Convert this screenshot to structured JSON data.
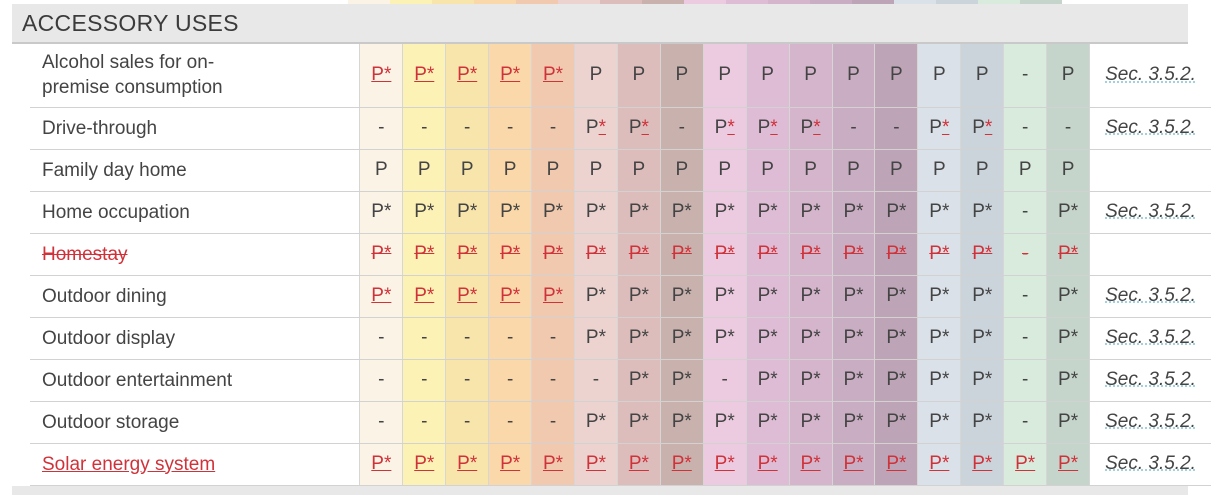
{
  "section": {
    "title": "ACCESSORY USES"
  },
  "column_colors": [
    "#faf3e6",
    "#fdf2b6",
    "#f8e5ac",
    "#fad8a9",
    "#f1c9ae",
    "#ecd3cf",
    "#dcbdbc",
    "#c9b2ae",
    "#eccbe0",
    "#dfbcd5",
    "#d4b5cb",
    "#c9adc2",
    "#bda5b7",
    "#dae1e8",
    "#cbd3db",
    "#d9ebdd",
    "#c5d5cc"
  ],
  "rows": [
    {
      "label": "Alcohol sales for on-premise consumption",
      "label_lines": [
        "Alcohol sales for on-",
        "premise consumption"
      ],
      "label_style": "normal",
      "cells": [
        [
          "P*",
          "ru"
        ],
        [
          "P*",
          "ru"
        ],
        [
          "P*",
          "ru"
        ],
        [
          "P*",
          "ru"
        ],
        [
          "P*",
          "ru"
        ],
        [
          "P",
          ""
        ],
        [
          "P",
          ""
        ],
        [
          "P",
          ""
        ],
        [
          "P",
          ""
        ],
        [
          "P",
          ""
        ],
        [
          "P",
          ""
        ],
        [
          "P",
          ""
        ],
        [
          "P",
          ""
        ],
        [
          "P",
          ""
        ],
        [
          "P",
          ""
        ],
        [
          "-",
          ""
        ],
        [
          "P",
          ""
        ]
      ],
      "ref": "Sec. 3.5.2."
    },
    {
      "label": "Drive-through",
      "label_style": "normal",
      "cells": [
        [
          "-",
          ""
        ],
        [
          "-",
          ""
        ],
        [
          "-",
          ""
        ],
        [
          "-",
          ""
        ],
        [
          "-",
          ""
        ],
        [
          "P*",
          "su"
        ],
        [
          "P*",
          "su"
        ],
        [
          "-",
          ""
        ],
        [
          "P*",
          "su"
        ],
        [
          "P*",
          "su"
        ],
        [
          "P*",
          "su"
        ],
        [
          "-",
          ""
        ],
        [
          "-",
          ""
        ],
        [
          "P*",
          "su"
        ],
        [
          "P*",
          "su"
        ],
        [
          "-",
          ""
        ],
        [
          "-",
          ""
        ]
      ],
      "ref": "Sec. 3.5.2."
    },
    {
      "label": "Family day home",
      "label_style": "normal",
      "cells": [
        [
          "P",
          ""
        ],
        [
          "P",
          ""
        ],
        [
          "P",
          ""
        ],
        [
          "P",
          ""
        ],
        [
          "P",
          ""
        ],
        [
          "P",
          ""
        ],
        [
          "P",
          ""
        ],
        [
          "P",
          ""
        ],
        [
          "P",
          ""
        ],
        [
          "P",
          ""
        ],
        [
          "P",
          ""
        ],
        [
          "P",
          ""
        ],
        [
          "P",
          ""
        ],
        [
          "P",
          ""
        ],
        [
          "P",
          ""
        ],
        [
          "P",
          ""
        ],
        [
          "P",
          ""
        ]
      ],
      "ref": ""
    },
    {
      "label": "Home occupation",
      "label_style": "normal",
      "cells": [
        [
          "P*",
          ""
        ],
        [
          "P*",
          ""
        ],
        [
          "P*",
          ""
        ],
        [
          "P*",
          ""
        ],
        [
          "P*",
          ""
        ],
        [
          "P*",
          ""
        ],
        [
          "P*",
          ""
        ],
        [
          "P*",
          ""
        ],
        [
          "P*",
          ""
        ],
        [
          "P*",
          ""
        ],
        [
          "P*",
          ""
        ],
        [
          "P*",
          ""
        ],
        [
          "P*",
          ""
        ],
        [
          "P*",
          ""
        ],
        [
          "P*",
          ""
        ],
        [
          "-",
          ""
        ],
        [
          "P*",
          ""
        ]
      ],
      "ref": "Sec. 3.5.2."
    },
    {
      "label": "Homestay",
      "label_style": "strike",
      "cells": [
        [
          "P*",
          "rs"
        ],
        [
          "P*",
          "rs"
        ],
        [
          "P*",
          "rs"
        ],
        [
          "P*",
          "rs"
        ],
        [
          "P*",
          "rs"
        ],
        [
          "P*",
          "rs"
        ],
        [
          "P*",
          "rs"
        ],
        [
          "P*",
          "rs"
        ],
        [
          "P*",
          "rs"
        ],
        [
          "P*",
          "rs"
        ],
        [
          "P*",
          "rs"
        ],
        [
          "P*",
          "rs"
        ],
        [
          "P*",
          "rs"
        ],
        [
          "P*",
          "rs"
        ],
        [
          "P*",
          "rs"
        ],
        [
          "-",
          "rs"
        ],
        [
          "P*",
          "rs"
        ]
      ],
      "ref": ""
    },
    {
      "label": "Outdoor dining",
      "label_style": "normal",
      "cells": [
        [
          "P*",
          "ru"
        ],
        [
          "P*",
          "ru"
        ],
        [
          "P*",
          "ru"
        ],
        [
          "P*",
          "ru"
        ],
        [
          "P*",
          "ru"
        ],
        [
          "P*",
          ""
        ],
        [
          "P*",
          ""
        ],
        [
          "P*",
          ""
        ],
        [
          "P*",
          ""
        ],
        [
          "P*",
          ""
        ],
        [
          "P*",
          ""
        ],
        [
          "P*",
          ""
        ],
        [
          "P*",
          ""
        ],
        [
          "P*",
          ""
        ],
        [
          "P*",
          ""
        ],
        [
          "-",
          ""
        ],
        [
          "P*",
          ""
        ]
      ],
      "ref": "Sec. 3.5.2."
    },
    {
      "label": "Outdoor display",
      "label_style": "normal",
      "cells": [
        [
          "-",
          ""
        ],
        [
          "-",
          ""
        ],
        [
          "-",
          ""
        ],
        [
          "-",
          ""
        ],
        [
          "-",
          ""
        ],
        [
          "P*",
          ""
        ],
        [
          "P*",
          ""
        ],
        [
          "P*",
          ""
        ],
        [
          "P*",
          ""
        ],
        [
          "P*",
          ""
        ],
        [
          "P*",
          ""
        ],
        [
          "P*",
          ""
        ],
        [
          "P*",
          ""
        ],
        [
          "P*",
          ""
        ],
        [
          "P*",
          ""
        ],
        [
          "-",
          ""
        ],
        [
          "P*",
          ""
        ]
      ],
      "ref": "Sec. 3.5.2."
    },
    {
      "label": "Outdoor entertainment",
      "label_style": "normal",
      "cells": [
        [
          "-",
          ""
        ],
        [
          "-",
          ""
        ],
        [
          "-",
          ""
        ],
        [
          "-",
          ""
        ],
        [
          "-",
          ""
        ],
        [
          "-",
          ""
        ],
        [
          "P*",
          ""
        ],
        [
          "P*",
          ""
        ],
        [
          "-",
          ""
        ],
        [
          "P*",
          ""
        ],
        [
          "P*",
          ""
        ],
        [
          "P*",
          ""
        ],
        [
          "P*",
          ""
        ],
        [
          "P*",
          ""
        ],
        [
          "P*",
          ""
        ],
        [
          "-",
          ""
        ],
        [
          "P*",
          ""
        ]
      ],
      "ref": "Sec. 3.5.2."
    },
    {
      "label": "Outdoor storage",
      "label_style": "normal",
      "cells": [
        [
          "-",
          ""
        ],
        [
          "-",
          ""
        ],
        [
          "-",
          ""
        ],
        [
          "-",
          ""
        ],
        [
          "-",
          ""
        ],
        [
          "P*",
          ""
        ],
        [
          "P*",
          ""
        ],
        [
          "P*",
          ""
        ],
        [
          "P*",
          ""
        ],
        [
          "P*",
          ""
        ],
        [
          "P*",
          ""
        ],
        [
          "P*",
          ""
        ],
        [
          "P*",
          ""
        ],
        [
          "P*",
          ""
        ],
        [
          "P*",
          ""
        ],
        [
          "-",
          ""
        ],
        [
          "P*",
          ""
        ]
      ],
      "ref": "Sec. 3.5.2."
    },
    {
      "label": "Solar energy system",
      "label_style": "redunder",
      "cells": [
        [
          "P*",
          "ru"
        ],
        [
          "P*",
          "ru"
        ],
        [
          "P*",
          "ru"
        ],
        [
          "P*",
          "ru"
        ],
        [
          "P*",
          "ru"
        ],
        [
          "P*",
          "ru"
        ],
        [
          "P*",
          "ru"
        ],
        [
          "P*",
          "ru"
        ],
        [
          "P*",
          "ru"
        ],
        [
          "P*",
          "ru"
        ],
        [
          "P*",
          "ru"
        ],
        [
          "P*",
          "ru"
        ],
        [
          "P*",
          "ru"
        ],
        [
          "P*",
          "ru"
        ],
        [
          "P*",
          "ru"
        ],
        [
          "P*",
          "ru"
        ],
        [
          "P*",
          "ru"
        ]
      ],
      "ref": "Sec. 3.5.2."
    }
  ]
}
